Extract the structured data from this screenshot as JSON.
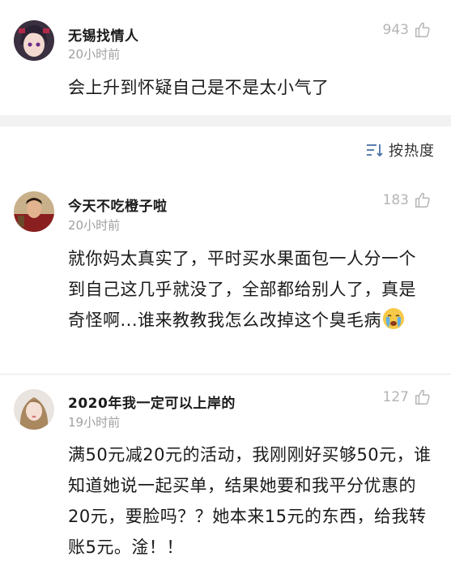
{
  "comments_top": {
    "username": "无锡找情人",
    "time": "20小时前",
    "likes": "943",
    "text": "会上升到怀疑自己是不是太小气了"
  },
  "sort": {
    "label": "按热度",
    "icon": "sort-icon"
  },
  "comments": [
    {
      "username": "今天不吃橙子啦",
      "time": "20小时前",
      "likes": "183",
      "text": "就你妈太真实了，平时买水果面包一人分一个到自己这几乎就没了，全部都给别人了，真是奇怪啊...谁来教教我怎么改掉这个臭毛病",
      "emoji": "crying-face-icon"
    },
    {
      "username": "2020年我一定可以上岸的",
      "time": "19小时前",
      "likes": "127",
      "text": "满50元减20元的活动，我刚刚好买够50元，谁知道她说一起买单，结果她要和我平分优惠的20元，要脸吗？？她本来15元的东西，给我转账5元。淦！！"
    }
  ],
  "colors": {
    "like_gray": "#b5b5b5",
    "time_gray": "#a0a0a0",
    "divider": "#f2f2f2"
  }
}
